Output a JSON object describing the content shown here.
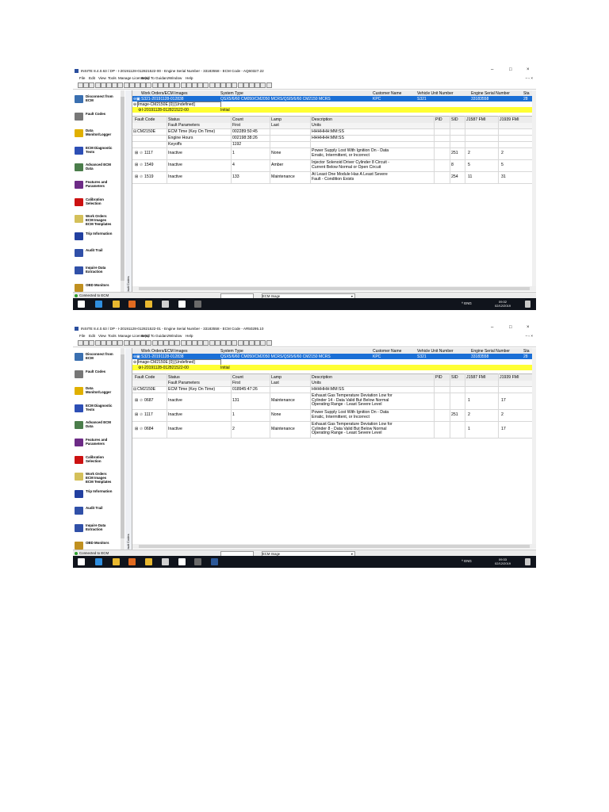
{
  "screenshots": [
    {
      "window_title": "INSITE 8.4.0.63  /  DP - I-20191128-012821522-00 - Engine Serial Number - 33183558 - ECM Code - AQ60327.22",
      "menu": [
        "File",
        "Edit",
        "View",
        "Tools",
        "Manage License(s)",
        "Send To Guidanz",
        "Window",
        "Help"
      ],
      "sidebar": [
        {
          "label": "Disconnect from\nECM",
          "icon": "disconnect-icon",
          "color": "#3a6fb0"
        },
        {
          "label": "Fault Codes",
          "icon": "fault-codes-icon",
          "color": "#777777"
        },
        {
          "label": "Data\nMonitor/Logger",
          "icon": "data-monitor-icon",
          "color": "#e0b000"
        },
        {
          "label": "ECM Diagnostic\nTests",
          "icon": "diagnostic-tests-icon",
          "color": "#2d4fb5"
        },
        {
          "label": "Advanced ECM\nData",
          "icon": "advanced-data-icon",
          "color": "#4b7d4b"
        },
        {
          "label": "Features and\nParameters",
          "icon": "features-icon",
          "color": "#6d2b86"
        },
        {
          "label": "Calibration\nSelection",
          "icon": "calibration-icon",
          "color": "#cc1111"
        },
        {
          "label": "Work Orders\nECM Images\nECM Templates",
          "icon": "work-orders-icon",
          "color": "#d4c05a"
        },
        {
          "label": "Trip Information",
          "icon": "trip-info-icon",
          "color": "#2240a0"
        },
        {
          "label": "Audit Trail",
          "icon": "audit-trail-icon",
          "color": "#3050a8"
        },
        {
          "label": "Inquire Data\nExtraction",
          "icon": "inquire-data-icon",
          "color": "#3050a8"
        },
        {
          "label": "OBD Monitors",
          "icon": "obd-monitors-icon",
          "color": "#c09020"
        }
      ],
      "fault_strip_label": "Fault Codes",
      "work_order": {
        "headers": [
          "Work Orders/ECM Images",
          "System Type",
          "Customer Name",
          "Vehicle Unit Number",
          "Engine Serial Number",
          "Sta"
        ],
        "row": [
          "S321-20191128-012838",
          "QSX5/6/60 CM050/CM2050 MCRS/QSI5/6/60 CM2150 MCRS",
          "KPC",
          "S321",
          "33183558",
          "28"
        ],
        "image_row": "Image-CM2150E [0] [Undefined]",
        "initial_row": [
          "I-20191128-012821522-00",
          "Initial"
        ]
      },
      "fault_headers": [
        "Fault Code",
        "Status",
        "Count",
        "Lamp",
        "Description",
        "PID",
        "SID",
        "J1587 FMI",
        "J1939 FMI"
      ],
      "param_header": [
        "Fault Parameters",
        "First",
        "Last",
        "Units"
      ],
      "params_group": "CM2150E",
      "params": [
        [
          "ECM Time (Key On Time)",
          "002289:50:45",
          "HHHHHH:MM:SS"
        ],
        [
          "Engine Hours",
          "002198:38:26",
          "HHHHHH:MM:SS"
        ],
        [
          "Keyoffs",
          "1192",
          ""
        ]
      ],
      "faults": [
        {
          "code": "1117",
          "status": "Inactive",
          "count": "1",
          "lamp": "None",
          "desc": "Power Supply Lost With Ignition On - Data\nErratic, Intermittent, or Incorrect",
          "pid": "",
          "sid": "251",
          "j1587": "2",
          "j1939": "2"
        },
        {
          "code": "1549",
          "status": "Inactive",
          "count": "4",
          "lamp": "Amber",
          "desc": "Injector Solenoid Driver Cylinder 8 Circuit -\nCurrent Below Normal or Open Circuit",
          "pid": "",
          "sid": "8",
          "j1587": "5",
          "j1939": "5"
        },
        {
          "code": "1519",
          "status": "Inactive",
          "count": "133",
          "lamp": "Maintenance",
          "desc": "At Least One Module Has A Least Severe\nFault - Condition Exists",
          "pid": "",
          "sid": "254",
          "j1587": "11",
          "j1939": "31"
        }
      ],
      "status": {
        "connection": "Connected to ECM",
        "combo": "ECM Image"
      },
      "clock": {
        "time": "09:32",
        "date": "02/12/2019"
      },
      "tray": "ENG"
    },
    {
      "window_title": "INSITE 8.4.0.63  /  DP - I-20191128-012821522-01 - Engine Serial Number - 33183558 - ECM Code - AR50295.10",
      "menu": [
        "File",
        "Edit",
        "View",
        "Tools",
        "Manage License(s)",
        "Send To Guidanz",
        "Window",
        "Help"
      ],
      "sidebar": [
        {
          "label": "Disconnect from\nECM",
          "icon": "disconnect-icon",
          "color": "#3a6fb0"
        },
        {
          "label": "Fault Codes",
          "icon": "fault-codes-icon",
          "color": "#777777"
        },
        {
          "label": "Data\nMonitor/Logger",
          "icon": "data-monitor-icon",
          "color": "#e0b000"
        },
        {
          "label": "ECM Diagnostic\nTests",
          "icon": "diagnostic-tests-icon",
          "color": "#2d4fb5"
        },
        {
          "label": "Advanced ECM\nData",
          "icon": "advanced-data-icon",
          "color": "#4b7d4b"
        },
        {
          "label": "Features and\nParameters",
          "icon": "features-icon",
          "color": "#6d2b86"
        },
        {
          "label": "Calibration\nSelection",
          "icon": "calibration-icon",
          "color": "#cc1111"
        },
        {
          "label": "Work Orders\nECM Images\nECM Templates",
          "icon": "work-orders-icon",
          "color": "#d4c05a"
        },
        {
          "label": "Trip Information",
          "icon": "trip-info-icon",
          "color": "#2240a0"
        },
        {
          "label": "Audit Trail",
          "icon": "audit-trail-icon",
          "color": "#3050a8"
        },
        {
          "label": "Inquire Data\nExtraction",
          "icon": "inquire-data-icon",
          "color": "#3050a8"
        },
        {
          "label": "OBD Monitors",
          "icon": "obd-monitors-icon",
          "color": "#c09020"
        }
      ],
      "fault_strip_label": "Fault Codes",
      "work_order": {
        "headers": [
          "Work Orders/ECM Images",
          "System Type",
          "Customer Name",
          "Vehicle Unit Number",
          "Engine Serial Number",
          "Sta"
        ],
        "row": [
          "S321-20191128-012838",
          "QSX5/6/60 CM050/CM2050 MCRS/QSI5/6/60 CM2150 MCRS",
          "KPC",
          "S321",
          "33183558",
          "28"
        ],
        "image_row": "Image-CM2150E [0] [Undefined]",
        "initial_row": [
          "I-20191128-012821522-00",
          "Initial"
        ]
      },
      "fault_headers": [
        "Fault Code",
        "Status",
        "Count",
        "Lamp",
        "Description",
        "PID",
        "SID",
        "J1587 FMI",
        "J1939 FMI"
      ],
      "param_header": [
        "Fault Parameters",
        "First",
        "Last",
        "Units"
      ],
      "params_group": "CM2150E",
      "params": [
        [
          "ECM Time (Key On Time)",
          "018945:47:26",
          "HHHHHH:MM:SS"
        ]
      ],
      "faults": [
        {
          "code": "0687",
          "status": "Inactive",
          "count": "131",
          "lamp": "Maintenance",
          "desc": "Exhaust Gas Temperature Deviation Low for\nCylinder 14 - Data Valid But Below Normal\nOperating Range - Least Severe Level",
          "pid": "",
          "sid": "",
          "j1587": "1",
          "j1939": "17"
        },
        {
          "code": "1117",
          "status": "Inactive",
          "count": "1",
          "lamp": "None",
          "desc": "Power Supply Lost With Ignition On - Data\nErratic, Intermittent, or Incorrect",
          "pid": "",
          "sid": "251",
          "j1587": "2",
          "j1939": "2"
        },
        {
          "code": "0684",
          "status": "Inactive",
          "count": "2",
          "lamp": "Maintenance",
          "desc": "Exhaust Gas Temperature Deviation Low for\nCylinder 8 - Data Valid But Below Normal\nOperating Range - Least Severe Level",
          "pid": "",
          "sid": "",
          "j1587": "1",
          "j1939": "17"
        }
      ],
      "status": {
        "connection": "Connected to ECM",
        "combo": "ECM Image"
      },
      "clock": {
        "time": "09:33",
        "date": "02/12/2019"
      },
      "tray": "ENG"
    }
  ]
}
